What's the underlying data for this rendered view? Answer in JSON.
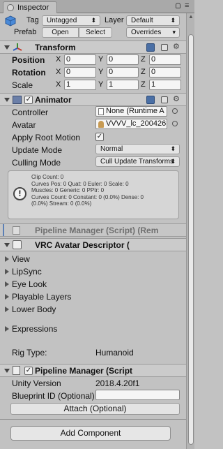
{
  "tab": {
    "title": "Inspector"
  },
  "header": {
    "tag_label": "Tag",
    "tag_value": "Untagged",
    "layer_label": "Layer",
    "layer_value": "Default",
    "prefab_label": "Prefab",
    "open_label": "Open",
    "select_label": "Select",
    "overrides_label": "Overrides"
  },
  "transform": {
    "title": "Transform",
    "position_label": "Position",
    "rotation_label": "Rotation",
    "scale_label": "Scale",
    "x_label": "X",
    "y_label": "Y",
    "z_label": "Z",
    "position": [
      "0",
      "0",
      "0"
    ],
    "rotation": [
      "0",
      "0",
      "0"
    ],
    "scale": [
      "1",
      "1",
      "1"
    ]
  },
  "animator": {
    "title": "Animator",
    "enabled": "✓",
    "controller_label": "Controller",
    "controller_value": "None (Runtime A",
    "avatar_label": "Avatar",
    "avatar_value": "VVVV_lc_200426",
    "apply_root_motion_label": "Apply Root Motion",
    "apply_root_motion_value": "✓",
    "update_mode_label": "Update Mode",
    "update_mode_value": "Normal",
    "culling_mode_label": "Culling Mode",
    "culling_mode_value": "Cull Update Transforms",
    "info": "Clip Count: 0\nCurves Pos: 0 Quat: 0 Euler: 0 Scale: 0\nMuscles: 0 Generic: 0 PPtr: 0\nCurves Count: 0 Constant: 0 (0.0%) Dense: 0\n(0.0%) Stream: 0 (0.0%)"
  },
  "pipeline_collapsed": {
    "title": "Pipeline Manager (Script) (Rem"
  },
  "vrc_descriptor": {
    "title": "VRC Avatar Descriptor (",
    "items": [
      "View",
      "LipSync",
      "Eye Look",
      "Playable Layers",
      "Lower Body"
    ],
    "expressions_label": "Expressions",
    "rig_type_label": "Rig Type:",
    "rig_type_value": "Humanoid"
  },
  "pipeline_manager": {
    "title": "Pipeline Manager (Script",
    "unity_version_label": "Unity Version",
    "unity_version_value": "2018.4.20f1",
    "blueprint_id_label": "Blueprint ID (Optional)",
    "blueprint_id_value": "",
    "attach_label": "Attach (Optional)"
  },
  "add_component_label": "Add Component",
  "icons": {
    "help": "help-book-icon",
    "preset": "preset-icon",
    "gear": "gear-icon",
    "transform": "transform-axes-icon",
    "animator": "animator-icon",
    "script": "script-icon"
  },
  "colors": {
    "background": "#c2c2c2",
    "header": "#cbcbcb",
    "help_icon": "#4a6fa5"
  }
}
